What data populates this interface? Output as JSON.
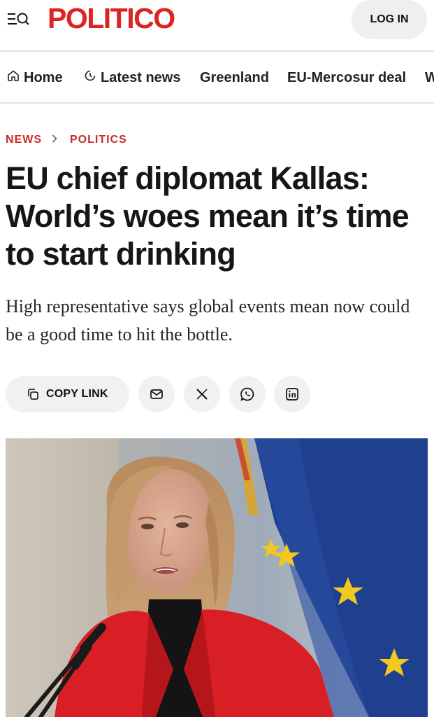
{
  "header": {
    "logo": "POLITICO",
    "login_label": "LOG IN"
  },
  "nav": {
    "items": [
      {
        "label": "Home",
        "icon": "home-icon"
      },
      {
        "label": "Latest news",
        "icon": "clock-icon"
      },
      {
        "label": "Greenland"
      },
      {
        "label": "EU-Mercosur deal"
      },
      {
        "label": "W"
      }
    ]
  },
  "breadcrumb": {
    "section": "NEWS",
    "subsection": "POLITICS"
  },
  "article": {
    "headline": "EU chief diplomat Kallas: World’s woes mean it’s time to start drinking",
    "dek": "High representative says global events mean now could be a good time to hit the bottle."
  },
  "share": {
    "copy_link_label": "COPY LINK",
    "buttons": [
      "mail-icon",
      "x-icon",
      "whatsapp-icon",
      "linkedin-icon"
    ]
  },
  "colors": {
    "brand_red": "#dc2423",
    "breadcrumb_red": "#c92a2a",
    "button_gray": "#f1f1f1"
  }
}
